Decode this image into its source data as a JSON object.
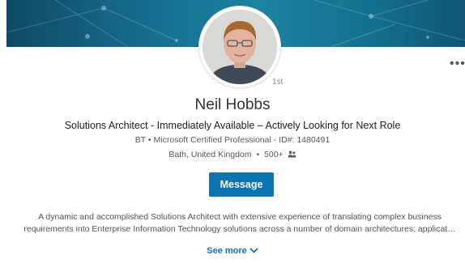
{
  "profile": {
    "name": "Neil Hobbs",
    "degree": "1st",
    "headline": "Solutions Architect - Immediately Available – Actively Looking for Next Role",
    "company_line": "BT • Microsoft Certified Professional - ID#: 1480491",
    "location": "Bath, United Kingdom",
    "location_separator": "•",
    "connections": "500+",
    "connections_icon": "people-icon",
    "avatar_icon": "profile-photo"
  },
  "actions": {
    "message_label": "Message",
    "overflow_label": "•••",
    "overflow_icon": "more-options-icon"
  },
  "summary": {
    "line1": "A dynamic and accomplished Solutions Architect with extensive experience of translating complex business",
    "line2": "requirements into Enterprise Information Technology solutions across a number of domain architectures; applicat…",
    "see_more_label": "See more",
    "see_more_icon": "chevron-down-icon"
  },
  "colors": {
    "banner": "#166d8d",
    "primary": "#0e73b1",
    "text": "#333333",
    "muted": "#5a5a5a"
  }
}
